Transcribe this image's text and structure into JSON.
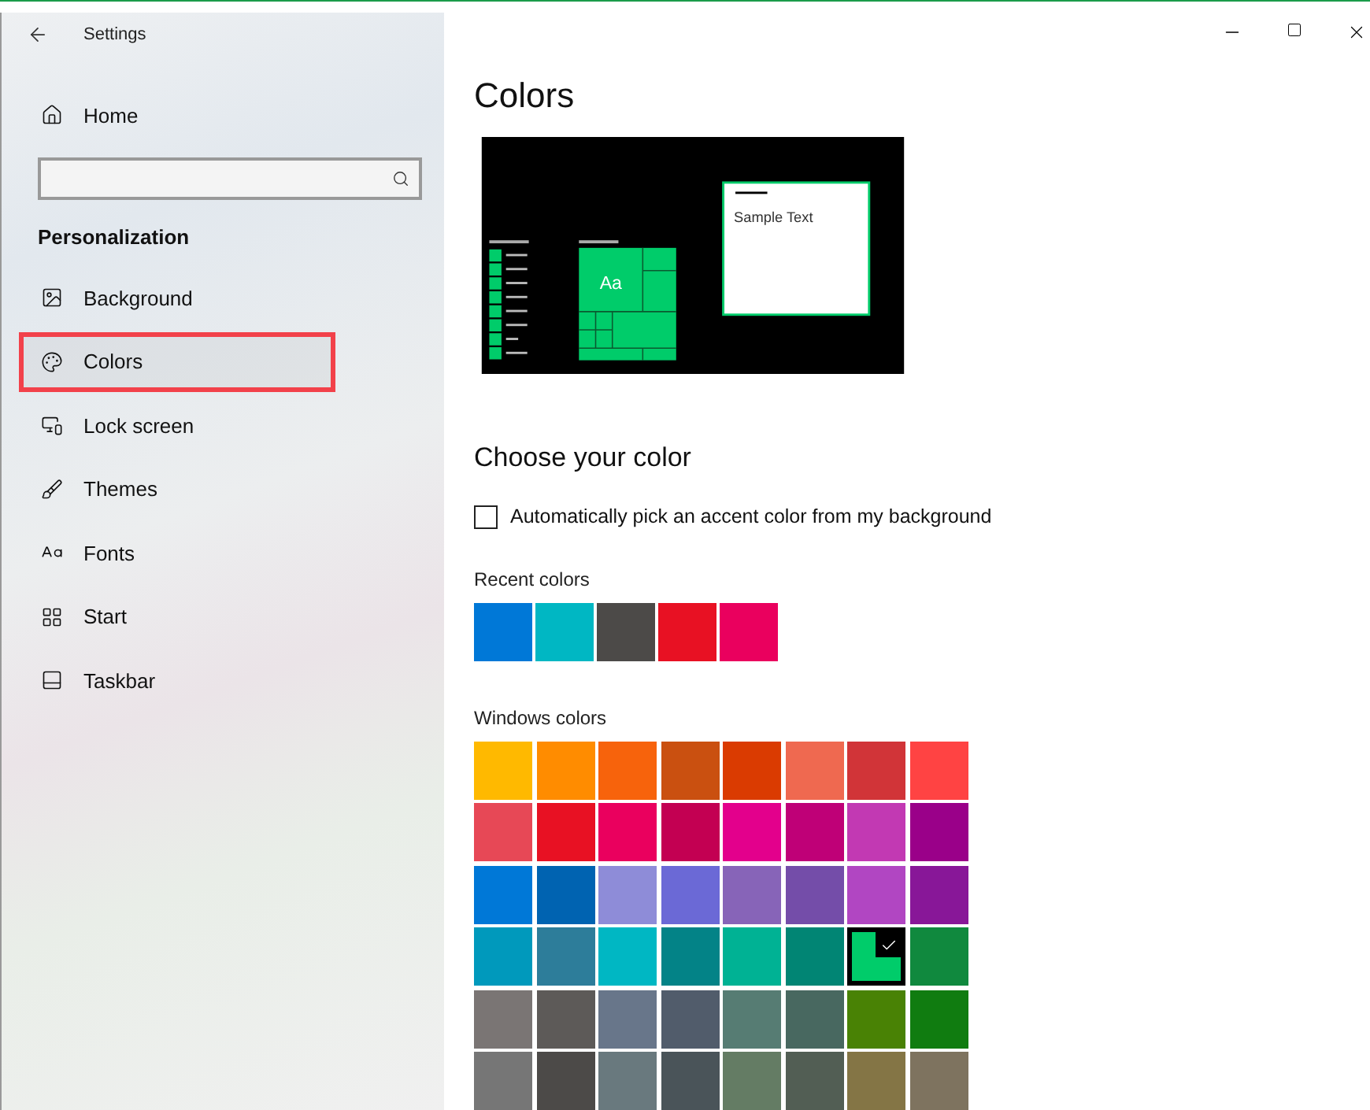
{
  "window": {
    "title": "Settings"
  },
  "sidebar": {
    "home": "Home",
    "section": "Personalization",
    "items": [
      {
        "label": "Background",
        "kind": "background",
        "selected": false
      },
      {
        "label": "Colors",
        "kind": "colors",
        "selected": true
      },
      {
        "label": "Lock screen",
        "kind": "lock",
        "selected": false
      },
      {
        "label": "Themes",
        "kind": "themes",
        "selected": false
      },
      {
        "label": "Fonts",
        "kind": "fonts",
        "selected": false
      },
      {
        "label": "Start",
        "kind": "start",
        "selected": false
      },
      {
        "label": "Taskbar",
        "kind": "taskbar",
        "selected": false
      }
    ]
  },
  "page": {
    "title": "Colors",
    "preview": {
      "tile_text": "Aa",
      "sample_text": "Sample Text"
    },
    "choose_heading": "Choose your color",
    "auto_pick": {
      "label": "Automatically pick an accent color from my background",
      "checked": false
    },
    "recent_label": "Recent colors",
    "recent_colors": [
      {
        "color": "#0078d7"
      },
      {
        "color": "#00b7c3"
      },
      {
        "color": "#4c4a48"
      },
      {
        "color": "#e81123"
      },
      {
        "color": "#ea005e"
      }
    ],
    "windows_label": "Windows colors",
    "windows_colors": [
      {
        "color": "#ffb900",
        "selected": false
      },
      {
        "color": "#ff8c00",
        "selected": false
      },
      {
        "color": "#f7630c",
        "selected": false
      },
      {
        "color": "#ca5010",
        "selected": false
      },
      {
        "color": "#da3b01",
        "selected": false
      },
      {
        "color": "#ef6950",
        "selected": false
      },
      {
        "color": "#d13438",
        "selected": false
      },
      {
        "color": "#ff4343",
        "selected": false
      },
      {
        "color": "#e74856",
        "selected": false
      },
      {
        "color": "#e81123",
        "selected": false
      },
      {
        "color": "#ea005e",
        "selected": false
      },
      {
        "color": "#c30052",
        "selected": false
      },
      {
        "color": "#e3008c",
        "selected": false
      },
      {
        "color": "#bf0077",
        "selected": false
      },
      {
        "color": "#c239b3",
        "selected": false
      },
      {
        "color": "#9a0089",
        "selected": false
      },
      {
        "color": "#0078d7",
        "selected": false
      },
      {
        "color": "#0063b1",
        "selected": false
      },
      {
        "color": "#8e8cd8",
        "selected": false
      },
      {
        "color": "#6b69d6",
        "selected": false
      },
      {
        "color": "#8764b8",
        "selected": false
      },
      {
        "color": "#744da9",
        "selected": false
      },
      {
        "color": "#b146c2",
        "selected": false
      },
      {
        "color": "#881798",
        "selected": false
      },
      {
        "color": "#0099bc",
        "selected": false
      },
      {
        "color": "#2d7d9a",
        "selected": false
      },
      {
        "color": "#00b7c3",
        "selected": false
      },
      {
        "color": "#038387",
        "selected": false
      },
      {
        "color": "#00b294",
        "selected": false
      },
      {
        "color": "#018574",
        "selected": false
      },
      {
        "color": "#00cc6a",
        "selected": true
      },
      {
        "color": "#10893e",
        "selected": false
      },
      {
        "color": "#7a7574",
        "selected": false
      },
      {
        "color": "#5d5a58",
        "selected": false
      },
      {
        "color": "#68768a",
        "selected": false
      },
      {
        "color": "#515c6b",
        "selected": false
      },
      {
        "color": "#567c73",
        "selected": false
      },
      {
        "color": "#486860",
        "selected": false
      },
      {
        "color": "#498205",
        "selected": false
      },
      {
        "color": "#107c10",
        "selected": false
      },
      {
        "color": "#767676",
        "selected": false
      },
      {
        "color": "#4c4a48",
        "selected": false
      },
      {
        "color": "#69797e",
        "selected": false
      },
      {
        "color": "#4a5459",
        "selected": false
      },
      {
        "color": "#647c64",
        "selected": false
      },
      {
        "color": "#525e54",
        "selected": false
      },
      {
        "color": "#847545",
        "selected": false
      },
      {
        "color": "#7e735f",
        "selected": false
      }
    ]
  }
}
